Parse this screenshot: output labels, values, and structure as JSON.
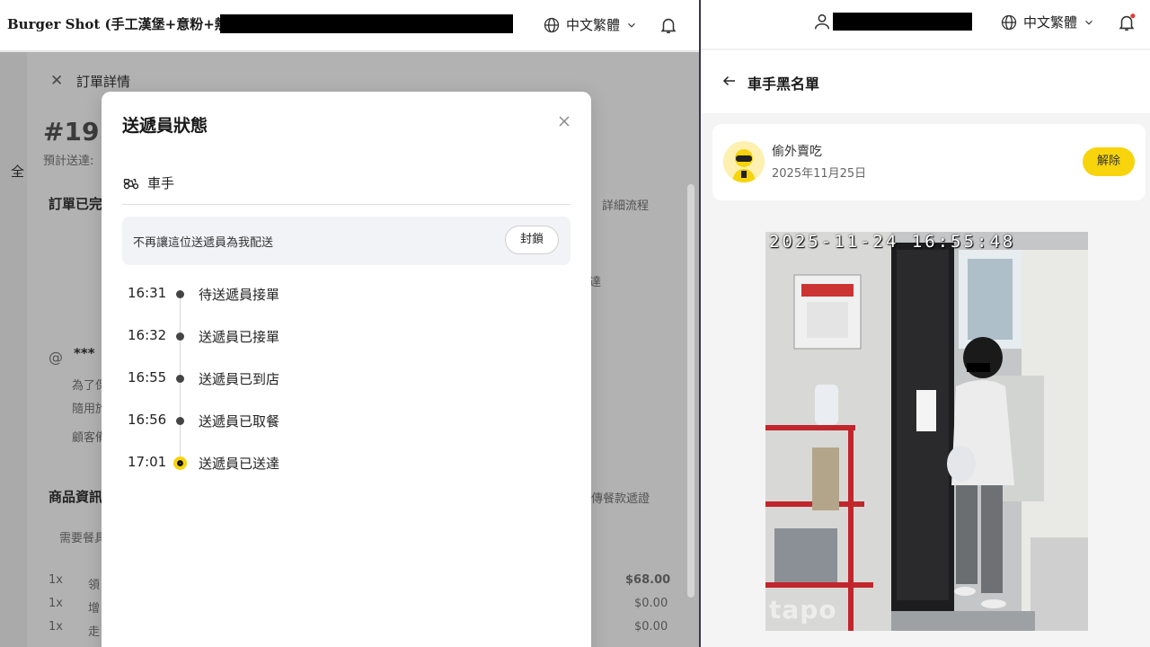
{
  "left_topbar": {
    "store_name": "Burger Shot (手工漢堡+意粉+熱狗)",
    "language": "中文繁體"
  },
  "background_page": {
    "panel_title": "訂單詳情",
    "order_number": "#191",
    "eta_prefix": "預計送達:",
    "tab_all": "全",
    "status_heading": "訂單已完",
    "detail_link": "詳細流程",
    "side_note": "達",
    "customer_masked": "***",
    "note_line1": "為了保",
    "note_line2": "隨用於",
    "note_line3": "顧客備",
    "products_heading": "商品資訊",
    "products_link": "傳餐款遞證",
    "need_utensils": "需要餐具",
    "items": [
      {
        "qty": "1x",
        "name": "領",
        "price": "$68.00"
      },
      {
        "qty": "1x",
        "name": "增",
        "price": "$0.00"
      },
      {
        "qty": "1x",
        "name": "走",
        "price": "$0.00"
      }
    ]
  },
  "modal": {
    "title": "送遞員狀態",
    "rider_label": "車手",
    "block_text": "不再讓這位送遞員為我配送",
    "block_button": "封鎖",
    "timeline": [
      {
        "time": "16:31",
        "status": "待送遞員接單",
        "active": false
      },
      {
        "time": "16:32",
        "status": "送遞員已接單",
        "active": false
      },
      {
        "time": "16:55",
        "status": "送遞員已到店",
        "active": false
      },
      {
        "time": "16:56",
        "status": "送遞員已取餐",
        "active": false
      },
      {
        "time": "17:01",
        "status": "送遞員已送達",
        "active": true
      }
    ]
  },
  "right_topbar": {
    "language": "中文繁體"
  },
  "blacklist": {
    "title": "車手黑名單",
    "rider_name": "偷外賣吃",
    "date": "2025年11月25日",
    "unblock_button": "解除"
  },
  "photo": {
    "timestamp": "2025-11-24 16:55:48",
    "watermark": "tapo"
  },
  "colors": {
    "accent_yellow": "#f7d40b",
    "divider": "#3b3450",
    "notification_dot": "#e53935"
  },
  "icons": [
    "globe-icon",
    "chevron-down-icon",
    "bell-icon",
    "user-icon",
    "close-icon",
    "scooter-icon",
    "back-arrow-icon",
    "rider-avatar-icon"
  ]
}
